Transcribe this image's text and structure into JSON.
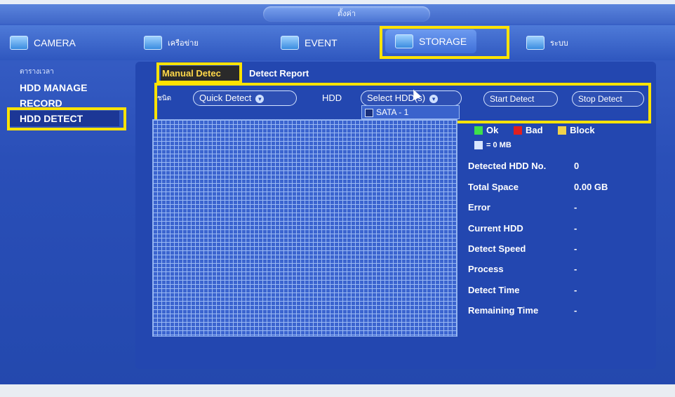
{
  "window": {
    "title": "ตั้งค่า"
  },
  "menu": {
    "camera": "CAMERA",
    "network": "เครือข่าย",
    "event": "EVENT",
    "storage": "STORAGE",
    "system": "ระบบ"
  },
  "sidebar": {
    "items": [
      {
        "label": "ตารางเวลา"
      },
      {
        "label": "HDD MANAGE"
      },
      {
        "label": "RECORD"
      },
      {
        "label": "HDD DETECT"
      }
    ]
  },
  "tabs": {
    "manual": "Manual Detec",
    "report": "Detect Report"
  },
  "controls": {
    "type_label": "ชนิด",
    "type_value": "Quick Detect",
    "hdd_label": "HDD",
    "hdd_select": "Select HDD(s)",
    "start_button": "Start Detect",
    "stop_button": "Stop Detect"
  },
  "dropdown": {
    "option": "SATA - 1"
  },
  "legend": {
    "ok": "Ok",
    "bad": "Bad",
    "block": "Block",
    "size": "= 0 MB",
    "colors": {
      "ok": "#3ee04a",
      "bad": "#e11f1f",
      "block": "#f0d24a",
      "size": "#d9e6ff"
    }
  },
  "info": {
    "detected_label": "Detected HDD No.",
    "detected_value": "0",
    "total_label": "Total Space",
    "total_value": "0.00 GB",
    "error_label": "Error",
    "error_value": "-",
    "current_label": "Current HDD",
    "current_value": "-",
    "speed_label": "Detect Speed",
    "speed_value": "-",
    "process_label": "Process",
    "process_value": "-",
    "time_label": "Detect Time",
    "time_value": "-",
    "remaining_label": "Remaining Time",
    "remaining_value": "-"
  }
}
